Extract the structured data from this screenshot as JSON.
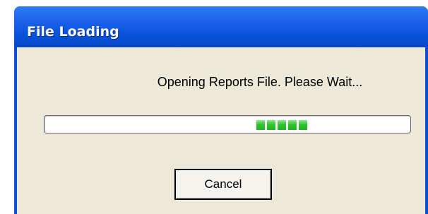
{
  "window": {
    "title": "File Loading"
  },
  "dialog": {
    "message": "Opening Reports File. Please Wait...",
    "progress": {
      "style": "marquee",
      "block_count": 5,
      "color": "#2fc52f"
    },
    "cancel_label": "Cancel"
  },
  "colors": {
    "titlebar": "#0a55dc",
    "client_background": "#ece9d8"
  }
}
